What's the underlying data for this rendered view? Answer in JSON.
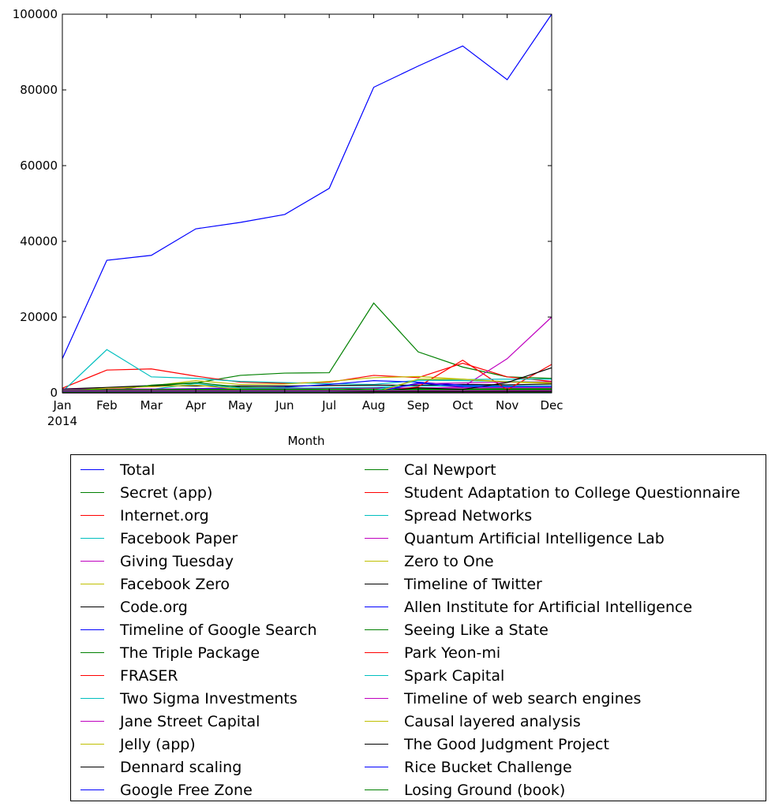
{
  "chart_data": {
    "type": "line",
    "title": "",
    "xlabel": "Month",
    "ylabel": "",
    "x": [
      "Jan",
      "Feb",
      "Mar",
      "Apr",
      "May",
      "Jun",
      "Jul",
      "Aug",
      "Sep",
      "Oct",
      "Nov",
      "Dec"
    ],
    "x_tick_labels": [
      "Jan",
      "Feb",
      "Mar",
      "Apr",
      "May",
      "Jun",
      "Jul",
      "Aug",
      "Sep",
      "Oct",
      "Nov",
      "Dec"
    ],
    "x_sub_label": "2014",
    "y_ticks": [
      0,
      20000,
      40000,
      60000,
      80000,
      100000
    ],
    "y_tick_labels": [
      "0",
      "20000",
      "40000",
      "60000",
      "80000",
      "100000"
    ],
    "ylim": [
      0,
      100000
    ],
    "grid": false,
    "legend_placement": "below",
    "series": [
      {
        "name": "Total",
        "color": "#0000ff",
        "values": [
          9000,
          35000,
          36300,
          43300,
          45000,
          47100,
          54000,
          80700,
          86300,
          91600,
          82700,
          100000
        ]
      },
      {
        "name": "Secret (app)",
        "color": "#008000",
        "values": [
          1000,
          1300,
          1800,
          2600,
          4600,
          5200,
          5300,
          23700,
          10800,
          6800,
          4200,
          3800
        ]
      },
      {
        "name": "Internet.org",
        "color": "#ff0000",
        "values": [
          1200,
          6000,
          6300,
          4400,
          2800,
          2500,
          2800,
          4600,
          4000,
          7800,
          4200,
          3000
        ]
      },
      {
        "name": "Facebook Paper",
        "color": "#00bfbf",
        "values": [
          300,
          11400,
          4200,
          3800,
          3000,
          2700,
          2400,
          2200,
          3300,
          3200,
          3000,
          2800
        ]
      },
      {
        "name": "Giving Tuesday",
        "color": "#bf00bf",
        "values": [
          200,
          300,
          300,
          300,
          300,
          400,
          500,
          1200,
          2000,
          1500,
          9000,
          20000
        ]
      },
      {
        "name": "Facebook Zero",
        "color": "#bfbf00",
        "values": [
          600,
          900,
          1800,
          3200,
          2200,
          2300,
          3000,
          4000,
          4300,
          3600,
          2800,
          2500
        ]
      },
      {
        "name": "Code.org",
        "color": "#000000",
        "values": [
          1000,
          1400,
          1900,
          1800,
          1800,
          1800,
          1900,
          2000,
          2000,
          2200,
          2100,
          2300
        ]
      },
      {
        "name": "Timeline of Google Search",
        "color": "#0000ff",
        "values": [
          800,
          900,
          1000,
          1100,
          1300,
          1500,
          2200,
          3200,
          2800,
          2000,
          1800,
          1800
        ]
      },
      {
        "name": "The Triple Package",
        "color": "#008000",
        "values": [
          200,
          400,
          2000,
          2700,
          1500,
          1300,
          1200,
          1100,
          1000,
          900,
          900,
          900
        ]
      },
      {
        "name": "FRASER",
        "color": "#ff0000",
        "values": [
          100,
          100,
          100,
          100,
          100,
          100,
          100,
          100,
          100,
          100,
          300,
          300
        ]
      },
      {
        "name": "Two Sigma Investments",
        "color": "#00bfbf",
        "values": [
          600,
          800,
          900,
          2400,
          1200,
          1200,
          1300,
          1500,
          1800,
          1800,
          1800,
          1800
        ]
      },
      {
        "name": "Jane Street Capital",
        "color": "#bf00bf",
        "values": [
          900,
          1000,
          1000,
          1000,
          1000,
          1000,
          1100,
          1200,
          1300,
          1300,
          1300,
          1300
        ]
      },
      {
        "name": "Jelly (app)",
        "color": "#bfbf00",
        "values": [
          400,
          1200,
          1600,
          2000,
          1000,
          600,
          500,
          500,
          500,
          400,
          400,
          400
        ]
      },
      {
        "name": "Dennard scaling",
        "color": "#000000",
        "values": [
          500,
          600,
          600,
          600,
          600,
          600,
          600,
          700,
          700,
          700,
          700,
          700
        ]
      },
      {
        "name": "Google Free Zone",
        "color": "#0000ff",
        "values": [
          300,
          300,
          400,
          400,
          400,
          400,
          400,
          400,
          400,
          400,
          400,
          400
        ]
      },
      {
        "name": "Cal Newport",
        "color": "#008000",
        "values": [
          700,
          800,
          800,
          900,
          900,
          900,
          1000,
          1000,
          1000,
          1000,
          1100,
          1100
        ]
      },
      {
        "name": "Student Adaptation to College Questionnaire",
        "color": "#ff0000",
        "values": [
          0,
          0,
          0,
          0,
          0,
          0,
          0,
          0,
          1600,
          8600,
          800,
          7500
        ]
      },
      {
        "name": "Spread Networks",
        "color": "#00bfbf",
        "values": [
          400,
          500,
          500,
          500,
          500,
          600,
          600,
          600,
          3300,
          3500,
          3600,
          3600
        ]
      },
      {
        "name": "Quantum Artificial Intelligence Lab",
        "color": "#bf00bf",
        "values": [
          100,
          100,
          200,
          200,
          200,
          200,
          300,
          300,
          2400,
          2600,
          2800,
          2900
        ]
      },
      {
        "name": "Zero to One",
        "color": "#bfbf00",
        "values": [
          0,
          0,
          0,
          0,
          0,
          0,
          0,
          0,
          3600,
          3600,
          2900,
          2700
        ]
      },
      {
        "name": "Timeline of Twitter",
        "color": "#000000",
        "values": [
          300,
          300,
          300,
          300,
          300,
          300,
          300,
          300,
          1300,
          900,
          2700,
          6600
        ]
      },
      {
        "name": "Allen Institute for Artificial Intelligence",
        "color": "#0000ff",
        "values": [
          0,
          0,
          0,
          0,
          0,
          0,
          0,
          0,
          2600,
          1600,
          1600,
          1600
        ]
      },
      {
        "name": "Seeing Like a State",
        "color": "#008000",
        "values": [
          600,
          700,
          700,
          700,
          700,
          700,
          700,
          700,
          700,
          700,
          800,
          800
        ]
      },
      {
        "name": "Park Yeon-mi",
        "color": "#ff0000",
        "values": [
          0,
          0,
          0,
          0,
          0,
          0,
          0,
          0,
          0,
          0,
          0,
          400
        ]
      },
      {
        "name": "Spark Capital",
        "color": "#00bfbf",
        "values": [
          300,
          300,
          300,
          300,
          300,
          300,
          300,
          300,
          300,
          300,
          300,
          300
        ]
      },
      {
        "name": "Timeline of web search engines",
        "color": "#bf00bf",
        "values": [
          500,
          500,
          500,
          500,
          500,
          500,
          500,
          500,
          500,
          500,
          500,
          500
        ]
      },
      {
        "name": "Causal layered analysis",
        "color": "#bfbf00",
        "values": [
          200,
          200,
          200,
          200,
          200,
          200,
          200,
          200,
          200,
          200,
          200,
          200
        ]
      },
      {
        "name": "The Good Judgment Project",
        "color": "#000000",
        "values": [
          200,
          200,
          200,
          200,
          200,
          200,
          200,
          300,
          300,
          300,
          300,
          300
        ]
      },
      {
        "name": "Rice Bucket Challenge",
        "color": "#0000ff",
        "values": [
          0,
          0,
          0,
          0,
          0,
          0,
          0,
          0,
          0,
          0,
          0,
          0
        ]
      },
      {
        "name": "Losing Ground (book)",
        "color": "#008000",
        "values": [
          100,
          100,
          100,
          100,
          100,
          100,
          100,
          100,
          100,
          100,
          100,
          100
        ]
      }
    ]
  }
}
